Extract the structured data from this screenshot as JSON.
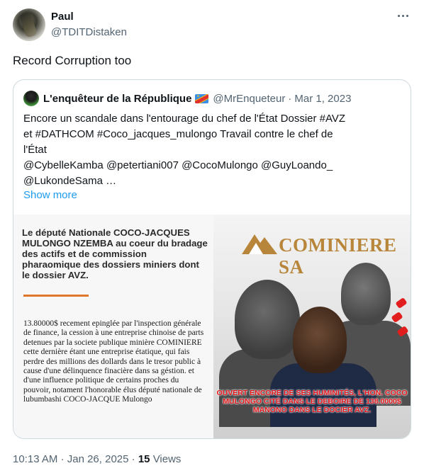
{
  "author": {
    "name": "Paul",
    "handle": "@TDITDistaken"
  },
  "tweet": {
    "text": "Record Corruption too"
  },
  "quote": {
    "name": "L'enquêteur de la République",
    "handle": "@MrEnqueteur",
    "separator": "·",
    "date": "Mar 1, 2023",
    "lines": [
      "Encore un scandale dans l'entourage du chef de l'État Dossier  #AVZ",
      "et #DATHCOM #Coco_jacques_mulongo Travail contre le chef de",
      "l'État",
      "@CybelleKamba @petertiani007 @CocoMulongo @GuyLoando_",
      "@LukondeSama …"
    ],
    "show_more": "Show more",
    "media": {
      "headline": "Le député Nationale COCO-JACQUES MULONGO NZEMBA au coeur du bradage des actifs et de commission pharaomique  des dossiers miniers dont le dossier AVZ.",
      "article": "13.80000$ recement  epinglée par l'inspection générale de finance, la cession à une entreprise chinoise de parts detenues par la societe  publique  minière  COMINIERE cette dernière étant une entreprise étatique, qui fais perdre des millions  des dollards dans le tresor public à cause d'une délinquence finacière dans sa géstion. et d'une influence politique de certains proches du pouvoir, notament l'honorable élus député nationale de lubumbashi COCO-JACQUE Mulongo",
      "logo_text": "COMINIERE SA",
      "caption": "OUVERT ENCORE DE SES HUMINITÉS, L'HON. COCO MULONGO CITÉ DANS LE  DEBOIRE DE 138.0000$ MANONO DANS LE  DOCIER AVZ."
    }
  },
  "footer": {
    "time": "10:13 AM",
    "dot1": "·",
    "date": "Jan 26, 2025",
    "dot2": "·",
    "views_count": "15",
    "views_label": "Views"
  },
  "colors": {
    "link": "#1d9bf0",
    "muted": "#536471",
    "text": "#0f1419",
    "border": "#cfd9de"
  },
  "icons": [
    "more-horizontal-icon",
    "verified-flag-icon"
  ]
}
